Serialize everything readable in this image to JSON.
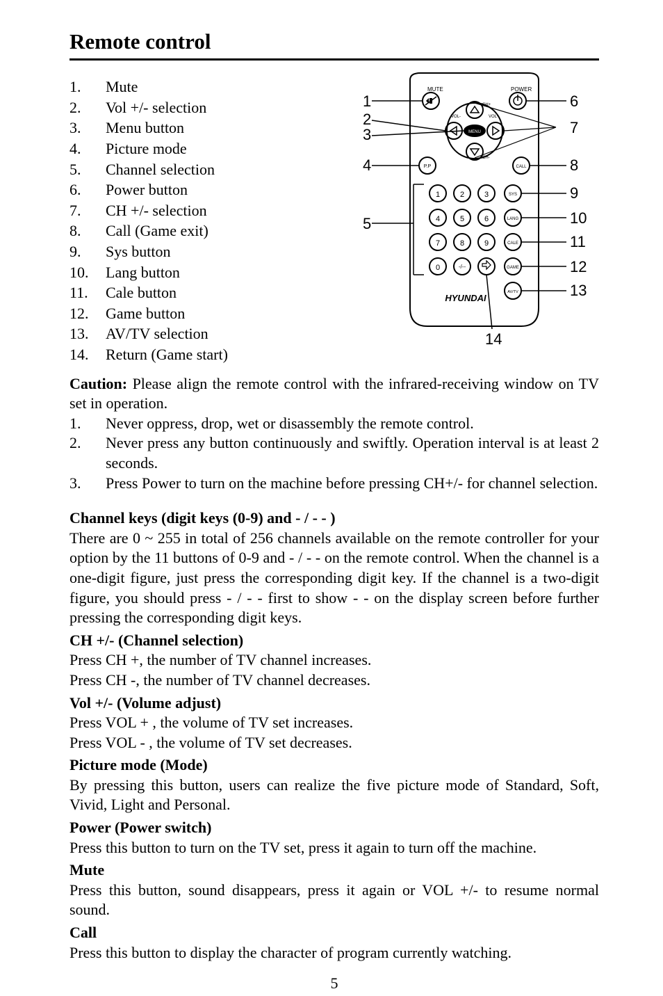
{
  "heading": "Remote control",
  "remote_list": [
    {
      "num": "1.",
      "label": "Mute"
    },
    {
      "num": "2.",
      "label": "Vol +/- selection"
    },
    {
      "num": "3.",
      "label": "Menu button"
    },
    {
      "num": "4.",
      "label": "Picture mode"
    },
    {
      "num": "5.",
      "label": "Channel selection"
    },
    {
      "num": "6.",
      "label": "Power button"
    },
    {
      "num": "7.",
      "label": "CH +/- selection"
    },
    {
      "num": "8.",
      "label": "Call (Game exit)"
    },
    {
      "num": "9.",
      "label": "Sys button"
    },
    {
      "num": "10.",
      "label": "Lang button"
    },
    {
      "num": "11.",
      "label": "Cale button"
    },
    {
      "num": "12.",
      "label": "Game button"
    },
    {
      "num": "13.",
      "label": "AV/TV selection"
    },
    {
      "num": "14.",
      "label": "Return (Game start)"
    }
  ],
  "diagram": {
    "left_numbers": [
      "1",
      "2",
      "3",
      "4",
      "5"
    ],
    "right_numbers": [
      "6",
      "7",
      "8",
      "9",
      "10",
      "11",
      "12",
      "13"
    ],
    "bottom_number": "14",
    "top_labels": {
      "mute": "MUTE",
      "power": "POWER"
    },
    "small": {
      "vol_minus": "VOL-",
      "vol_plus": "VOL+",
      "ch_plus": "CH+",
      "ch_minus": "CH-",
      "menu": "MENU",
      "pp": "P.P",
      "call": "CALL",
      "sys": "SYS",
      "lang": "LANG",
      "cale": "CALE",
      "game": "GAME",
      "avtv": "AV/TV"
    },
    "keypad": [
      "1",
      "2",
      "3",
      "4",
      "5",
      "6",
      "7",
      "8",
      "9",
      "0",
      "-/--"
    ],
    "logo": "HYUNDAI"
  },
  "caution_label": "Caution:",
  "caution_intro": " Please align the remote control with the infrared-receiving window on TV set in operation.",
  "caution_items": [
    {
      "num": "1.",
      "text": "Never oppress, drop, wet or disassembly the remote control."
    },
    {
      "num": "2.",
      "text": "Never press any button continuously and swiftly. Operation interval is at least 2 seconds."
    },
    {
      "num": "3.",
      "text": "Press Power to turn on the machine before pressing CH+/- for channel selection."
    }
  ],
  "sections": {
    "channel_keys_heading": "Channel keys (digit keys (0-9) and - / - - )",
    "channel_keys_body": "There are 0 ~ 255 in total of 256 channels available on the remote controller for your option by the 11 buttons of 0-9 and - / - - on the remote control. When the channel is a one-digit figure, just press the corresponding digit key. If the channel is a two-digit figure, you should press - / - - first to show - - on the display screen before further pressing the corresponding digit keys.",
    "ch_sel_heading": "CH +/- (Channel selection)",
    "ch_sel_1": "Press CH +, the number of TV channel increases.",
    "ch_sel_2": "Press CH -, the number of TV channel decreases.",
    "vol_heading": "Vol +/- (Volume adjust)",
    "vol_1": "Press VOL + , the volume of TV set increases.",
    "vol_2": "Press VOL - , the volume of TV set decreases.",
    "picture_heading": "Picture mode (Mode)",
    "picture_body": "By pressing this button, users can realize the five picture mode of Standard, Soft, Vivid, Light and Personal.",
    "power_heading": "Power (Power switch)",
    "power_body": "Press this button to turn on the TV set, press it again to turn off the machine.",
    "mute_heading": "Mute",
    "mute_body": "Press this button, sound disappears, press it again or VOL +/- to resume normal sound.",
    "call_heading": "Call",
    "call_body": "Press this button to display the character of program currently watching."
  },
  "page_number": "5"
}
